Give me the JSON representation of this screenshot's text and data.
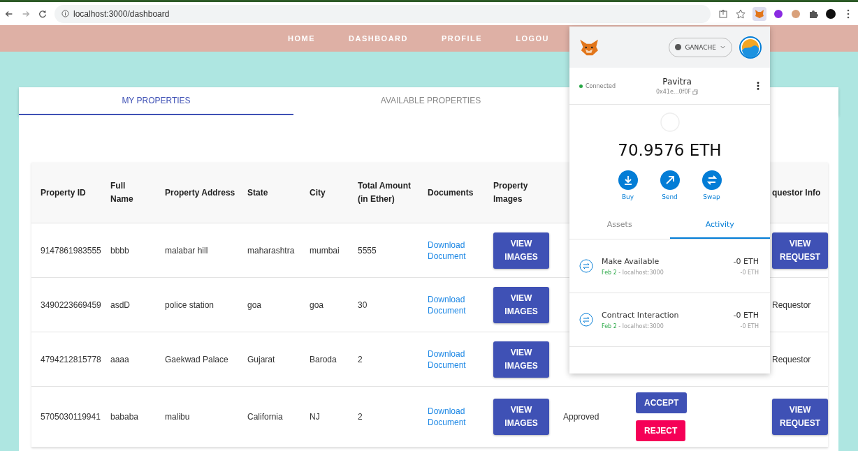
{
  "browser": {
    "url": "localhost:3000/dashboard"
  },
  "nav": [
    {
      "label": "HOME"
    },
    {
      "label": "DASHBOARD"
    },
    {
      "label": "PROFILE"
    },
    {
      "label": "LOGOU"
    }
  ],
  "tabs": [
    {
      "label": "MY PROPERTIES",
      "selected": true
    },
    {
      "label": "AVAILABLE PROPERTIES",
      "selected": false
    }
  ],
  "table": {
    "columns": [
      "Property ID",
      "Full Name",
      "Property Address",
      "State",
      "City",
      "Total Amount (in Ether)",
      "Documents",
      "Property Images",
      "questor Info"
    ],
    "rows": [
      {
        "id": "9147861983555",
        "name": "bbbb",
        "address": "malabar hill",
        "state": "maharashtra",
        "city": "mumbai",
        "amount": "5555",
        "document": "Download Document",
        "images": "VIEW IMAGES",
        "requestor": {
          "kind": "button",
          "label": "VIEW REQUEST"
        }
      },
      {
        "id": "3490223669459",
        "name": "asdD",
        "address": "police station",
        "state": "goa",
        "city": "goa",
        "amount": "30",
        "document": "Download Document",
        "images": "VIEW IMAGES",
        "requestor": {
          "kind": "text",
          "label": "Requestor"
        }
      },
      {
        "id": "4794212815778",
        "name": "aaaa",
        "address": "Gaekwad Palace",
        "state": "Gujarat",
        "city": "Baroda",
        "amount": "2",
        "document": "Download Document",
        "images": "VIEW IMAGES",
        "requestor": {
          "kind": "text",
          "label": "Requestor"
        }
      },
      {
        "id": "5705030119941",
        "name": "bababa",
        "address": "malibu",
        "state": "California",
        "city": "NJ",
        "amount": "2",
        "document": "Download Document",
        "images": "VIEW IMAGES",
        "status": "Approved",
        "actions": [
          {
            "kind": "accept",
            "label": "ACCEPT"
          },
          {
            "kind": "reject",
            "label": "REJECT"
          }
        ],
        "requestor": {
          "kind": "button",
          "label": "VIEW REQUEST"
        }
      }
    ]
  },
  "wallet": {
    "network": "GANACHE",
    "status": "Connected",
    "account": "Pavitra",
    "address": "0x41e...0f0F",
    "balance": "70.9576 ETH",
    "actions": [
      {
        "kind": "buy",
        "label": "Buy"
      },
      {
        "kind": "send",
        "label": "Send"
      },
      {
        "kind": "swap",
        "label": "Swap"
      }
    ],
    "tabs": [
      {
        "label": "Assets",
        "selected": false
      },
      {
        "label": "Activity",
        "selected": true
      }
    ],
    "activity": [
      {
        "title": "Make Available",
        "date": "Feb 2",
        "origin": "- localhost:3000",
        "amount": "-0 ETH",
        "sub_amount": "-0 ETH"
      },
      {
        "title": "Contract Interaction",
        "date": "Feb 2",
        "origin": "- localhost:3000",
        "amount": "-0 ETH",
        "sub_amount": "-0 ETH"
      }
    ]
  }
}
